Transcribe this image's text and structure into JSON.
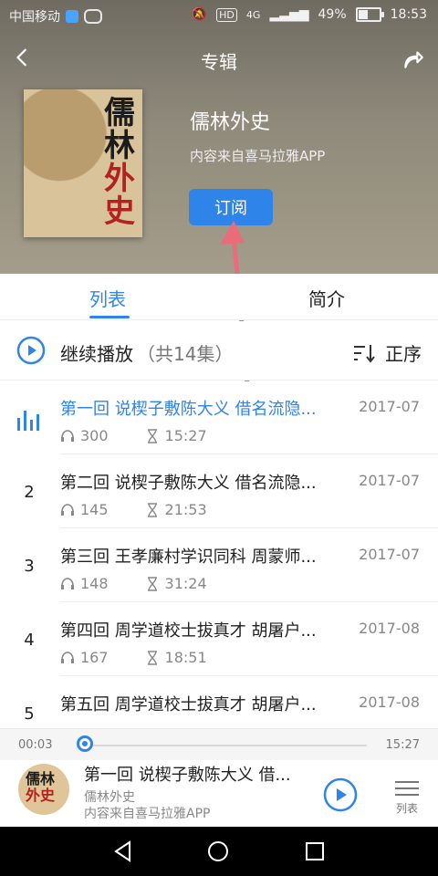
{
  "status_bar": {
    "carrier": "中国移动",
    "network": "HD",
    "signal": "4G",
    "battery": "49%",
    "battery_fraction": 0.49,
    "time": "18:53"
  },
  "header": {
    "title": "专辑"
  },
  "album": {
    "cover_title_chars": [
      "儒",
      "林",
      "外",
      "史"
    ],
    "name": "儒林外史",
    "source": "内容来自喜马拉雅APP",
    "subscribe_label": "订阅"
  },
  "tabs": [
    {
      "label": "列表",
      "active": true
    },
    {
      "label": "简介",
      "active": false
    }
  ],
  "continue_bar": {
    "label": "继续播放",
    "count": "（共14集）",
    "order_label": "正序"
  },
  "episodes": [
    {
      "index": "1",
      "title": "第一回 说楔子敷陈大义 借名流隐...",
      "date": "2017-07",
      "plays": "300",
      "duration": "15:27",
      "playing": true
    },
    {
      "index": "2",
      "title": "第二回 说楔子敷陈大义 借名流隐...",
      "date": "2017-07",
      "plays": "145",
      "duration": "21:53",
      "playing": false
    },
    {
      "index": "3",
      "title": "第三回 王孝廉村学识同科 周蒙师...",
      "date": "2017-07",
      "plays": "148",
      "duration": "31:24",
      "playing": false
    },
    {
      "index": "4",
      "title": "第四回 周学道校士拔真才 胡屠户...",
      "date": "2017-08",
      "plays": "167",
      "duration": "18:51",
      "playing": false
    },
    {
      "index": "5",
      "title": "第五回 周学道校士拔真才 胡屠户...",
      "date": "2017-08",
      "plays": "",
      "duration": "",
      "playing": false
    }
  ],
  "player": {
    "elapsed": "00:03",
    "total": "15:27",
    "progress_fraction": 0.003,
    "now_playing_title": "第一回 说楔子敷陈大义 借...",
    "album": "儒林外史",
    "source": "内容来自喜马拉雅APP",
    "list_label": "列表"
  },
  "colors": {
    "accent": "#2f84ea",
    "arrow": "#ea6b7a"
  },
  "icons": [
    "back-icon",
    "share-icon",
    "play-circle-icon",
    "order-icon",
    "equalizer-icon",
    "headphone-icon",
    "hourglass-icon",
    "list-icon",
    "nav-back-icon",
    "nav-home-icon",
    "nav-recent-icon"
  ]
}
